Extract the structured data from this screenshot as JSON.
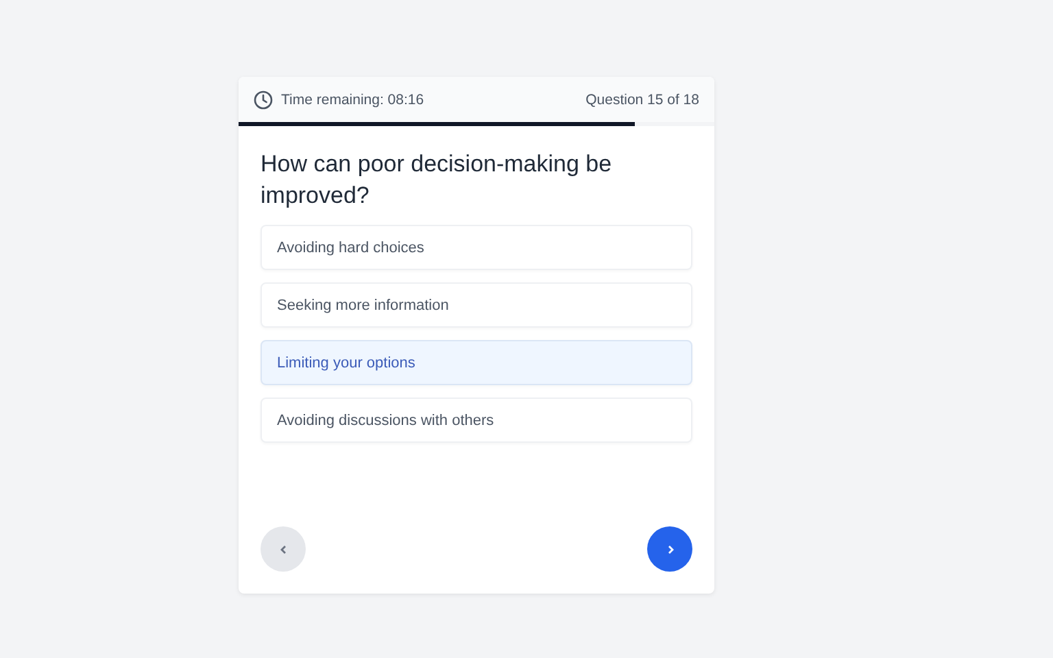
{
  "header": {
    "timer": "Time remaining: 08:16",
    "counter": "Question 15 of 18"
  },
  "progress": {
    "level": 0.833
  },
  "question": "How can poor decision-making be improved?",
  "options": [
    {
      "label": "Avoiding hard choices",
      "selected": false
    },
    {
      "label": "Seeking more information",
      "selected": false
    },
    {
      "label": "Limiting your options",
      "selected": true
    },
    {
      "label": "Avoiding discussions with others",
      "selected": false
    }
  ],
  "navigation": {
    "previous": {
      "disabled": true
    },
    "next": {
      "disabled": false
    }
  }
}
